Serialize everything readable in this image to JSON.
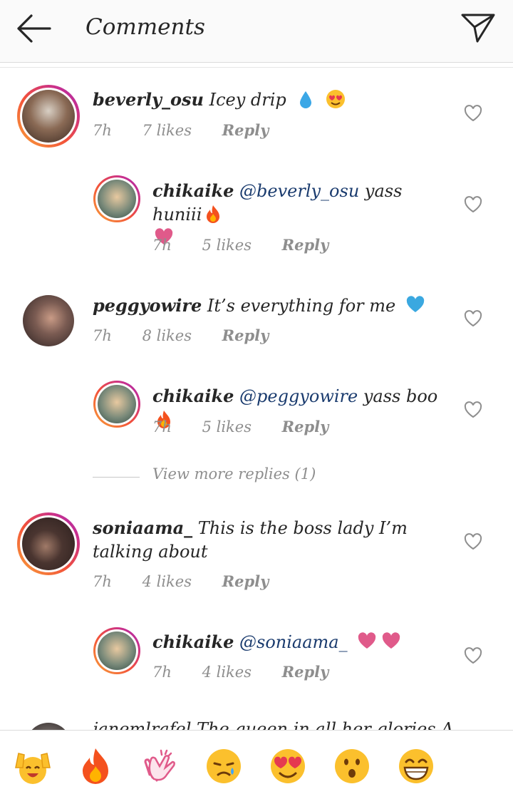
{
  "header": {
    "title": "Comments"
  },
  "comments": [
    {
      "username": "beverly_osu",
      "text": "Icey drip",
      "time": "7h",
      "likes": "7 likes",
      "reply": "Reply"
    },
    {
      "username": "chikaike",
      "mention": "@beverly_osu",
      "text": "yass huniii",
      "time": "7h",
      "likes": "5 likes",
      "reply": "Reply"
    },
    {
      "username": "peggyowire",
      "text": "It’s everything for me",
      "time": "7h",
      "likes": "8 likes",
      "reply": "Reply"
    },
    {
      "username": "chikaike",
      "mention": "@peggyowire",
      "text": "yass boo",
      "time": "7h",
      "likes": "5 likes",
      "reply": "Reply"
    },
    {
      "username": "soniaama_",
      "text": "This is the boss lady I’m talking about",
      "time": "7h",
      "likes": "4 likes",
      "reply": "Reply"
    },
    {
      "username": "chikaike",
      "mention": "@soniaama_",
      "text": "",
      "time": "7h",
      "likes": "4 likes",
      "reply": "Reply"
    }
  ],
  "view_more": "View more replies (1)",
  "partial_comment": "janemlrafel The queen in all her glories A",
  "emoji_bar": [
    "raising-hands",
    "fire",
    "clapping-hands",
    "crying-face",
    "heart-eyes",
    "surprised-face",
    "grinning-face"
  ],
  "colors": {
    "ring_start": "#f8a23a",
    "ring_end": "#9b2fb5",
    "mention": "#1a3b6e",
    "meta": "#8e8e8e"
  }
}
